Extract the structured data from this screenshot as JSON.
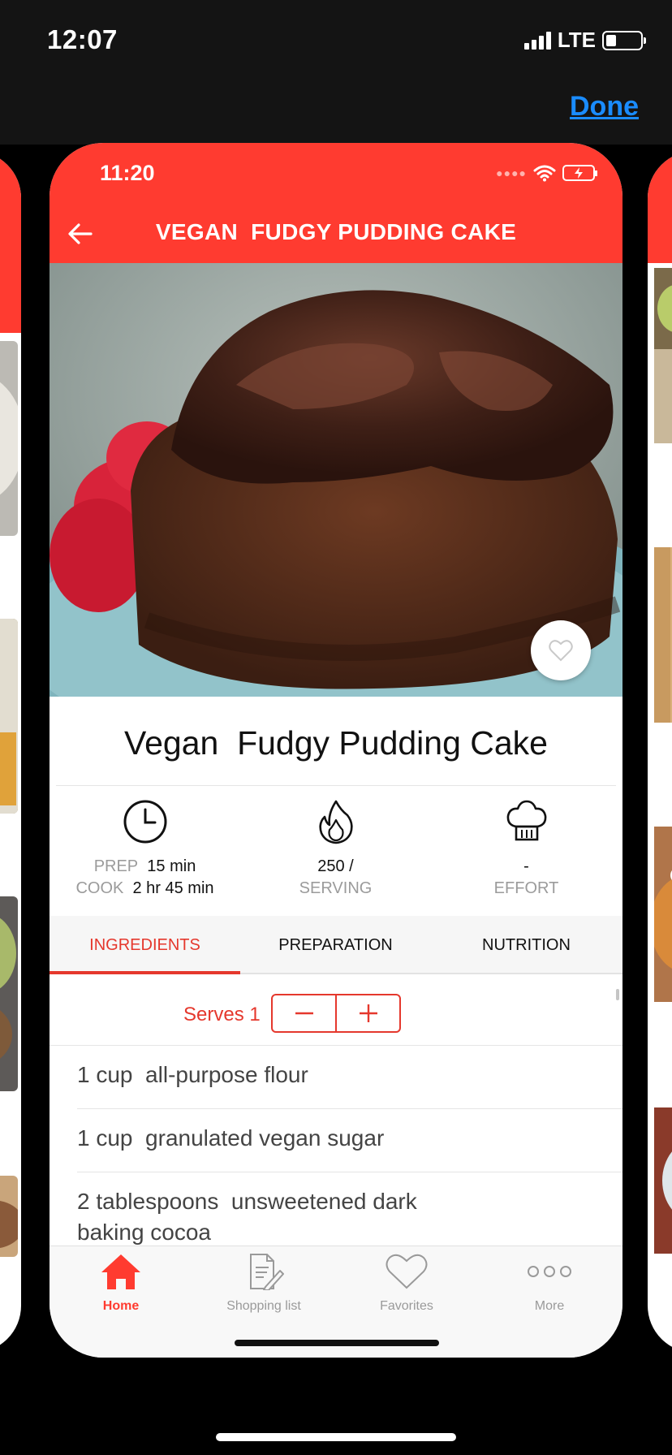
{
  "outer_status": {
    "time": "12:07",
    "network": "LTE"
  },
  "outer_nav": {
    "done_label": "Done"
  },
  "inner_status": {
    "time": "11:20"
  },
  "header": {
    "title": "VEGAN  FUDGY PUDDING CAKE"
  },
  "recipe": {
    "title": "Vegan  Fudgy Pudding Cake"
  },
  "stats": {
    "time": {
      "prep_label": "PREP",
      "prep_value": "15 min",
      "cook_label": "COOK",
      "cook_value": "2 hr 45 min"
    },
    "calories": {
      "value": "250 /",
      "label": "SERVING"
    },
    "effort": {
      "value": "-",
      "label": "EFFORT"
    }
  },
  "tabs": [
    {
      "label": "INGREDIENTS",
      "active": true
    },
    {
      "label": "PREPARATION",
      "active": false
    },
    {
      "label": "NUTRITION",
      "active": false
    }
  ],
  "serves": {
    "label": "Serves 1"
  },
  "ingredients": [
    "1 cup  all-purpose flour",
    "1 cup  granulated vegan sugar",
    "2 tablespoons  unsweetened dark",
    "baking cocoa"
  ],
  "bottom_nav": [
    {
      "label": "Home",
      "icon": "home-icon",
      "active": true
    },
    {
      "label": "Shopping list",
      "icon": "shopping-list-icon",
      "active": false
    },
    {
      "label": "Favorites",
      "icon": "heart-icon",
      "active": false
    },
    {
      "label": "More",
      "icon": "more-icon",
      "active": false
    }
  ],
  "colors": {
    "accent": "#ff3b30",
    "tab_active": "#e5382d",
    "link": "#1a8cff"
  }
}
